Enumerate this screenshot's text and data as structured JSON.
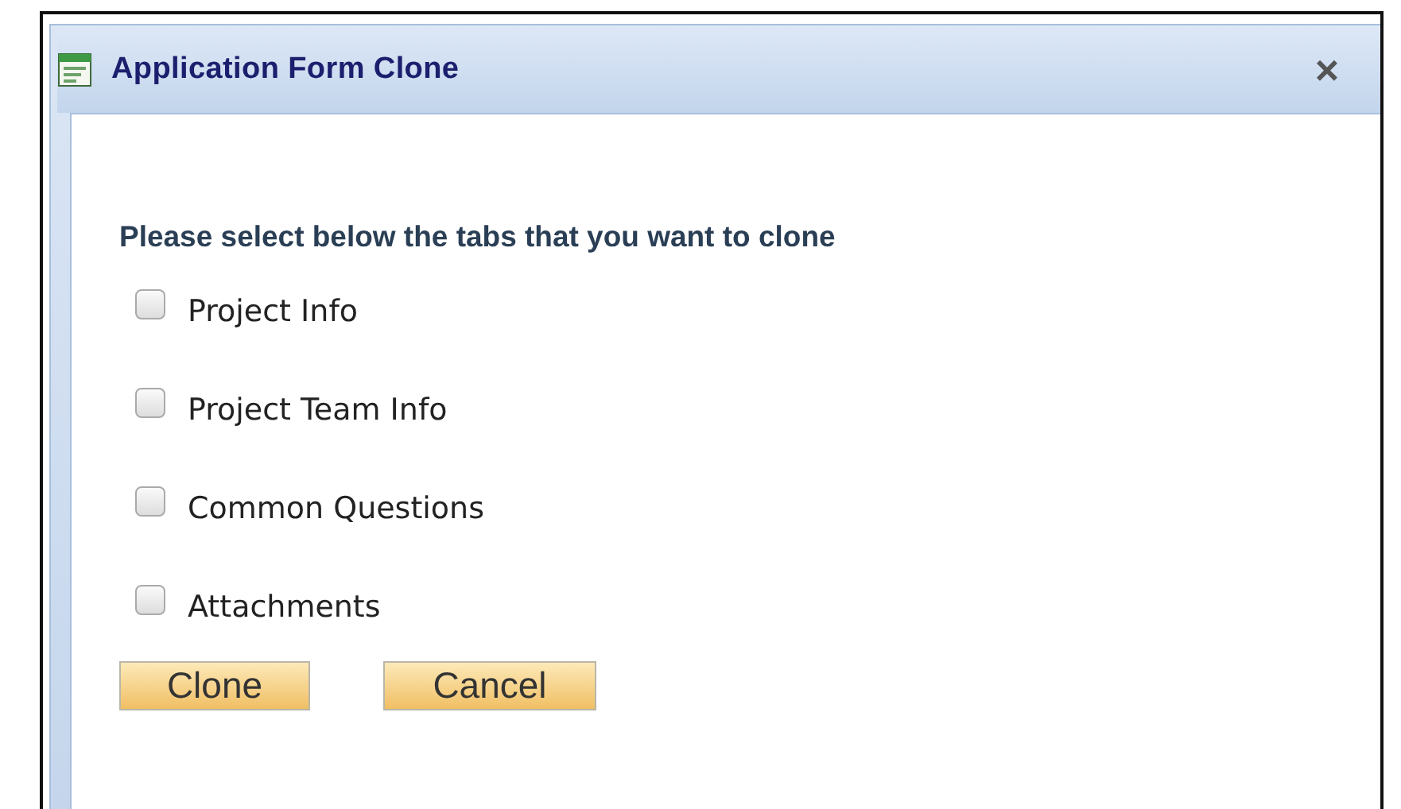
{
  "window": {
    "title": "Application Form Clone",
    "close": "×"
  },
  "heading": "Please select below the tabs that you want to clone",
  "options": [
    {
      "label": "Project Info",
      "checked": false
    },
    {
      "label": "Project Team Info",
      "checked": false
    },
    {
      "label": "Common Questions",
      "checked": false
    },
    {
      "label": "Attachments",
      "checked": false
    }
  ],
  "buttons": [
    "Clone",
    "Cancel"
  ]
}
